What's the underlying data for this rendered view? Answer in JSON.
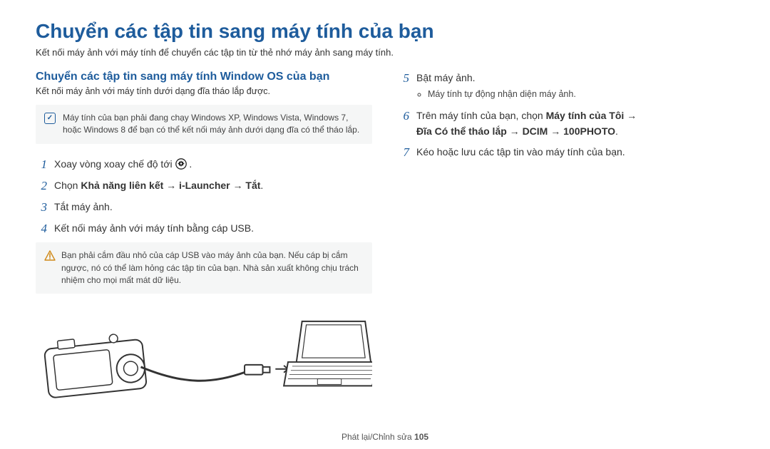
{
  "title": "Chuyển các tập tin sang máy tính của bạn",
  "subtitle": "Kết nối máy ảnh với máy tính để chuyển các tập tin từ thẻ nhớ máy ảnh sang máy tính.",
  "section": {
    "heading": "Chuyển các tập tin sang máy tính Window OS của bạn",
    "sub": "Kết nối máy ảnh với máy tính dưới dạng đĩa tháo lắp được."
  },
  "note_info": "Máy tính của bạn phải đang chạy Windows XP, Windows Vista, Windows 7, hoặc Windows 8 để bạn có thể kết nối máy ảnh dưới dạng đĩa có thể tháo lắp.",
  "note_warn": "Bạn phải cắm đầu nhỏ của cáp USB vào máy ảnh của bạn. Nếu cáp bị cắm ngược, nó có thể làm hỏng các tập tin của bạn. Nhà sản xuất không chịu trách nhiệm cho mọi mất mát dữ liệu.",
  "steps_left": [
    {
      "n": "1",
      "pre": "Xoay vòng xoay chế độ tới ",
      "after": "."
    },
    {
      "n": "2",
      "pre": "Chọn ",
      "bold": "Khả năng liên kết → i-Launcher → Tắt",
      "after": "."
    },
    {
      "n": "3",
      "pre": "Tắt máy ảnh."
    },
    {
      "n": "4",
      "pre": "Kết nối máy ảnh với máy tính bằng cáp USB."
    }
  ],
  "steps_right": [
    {
      "n": "5",
      "pre": "Bật máy ảnh.",
      "sub": [
        "Máy tính tự động nhận diện máy ảnh."
      ]
    },
    {
      "n": "6",
      "pre": "Trên máy tính của bạn, chọn ",
      "bold_runs": [
        "Máy tính của Tôi",
        " → "
      ],
      "bold_line2": "Đĩa Có thể tháo lắp → DCIM → 100PHOTO",
      "after": "."
    },
    {
      "n": "7",
      "pre": "Kéo hoặc lưu các tập tin vào máy tính của bạn."
    }
  ],
  "footer": {
    "text": "Phát lại/Chỉnh sửa  ",
    "page": "105"
  }
}
